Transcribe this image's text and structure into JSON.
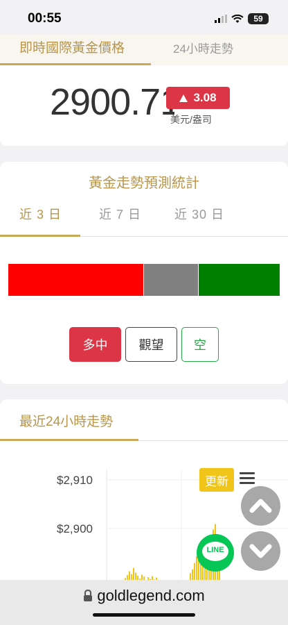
{
  "status_bar": {
    "time": "00:55",
    "battery": "59"
  },
  "top_tabs": {
    "realtime_label": "即時國際黃金價格",
    "trend24h_label": "24小時走勢"
  },
  "price": {
    "value": "2900.71",
    "change": "3.08",
    "change_direction": "up",
    "unit": "美元/盎司"
  },
  "forecast": {
    "title": "黃金走勢預測統計",
    "periods": [
      "近 3 日",
      "近 7 日",
      "近 30 日"
    ],
    "active_period_index": 0,
    "distribution_percent": {
      "long": 50,
      "watch": 20,
      "short": 30
    },
    "legend": {
      "long_label": "多中",
      "watch_label": "觀望",
      "short_label": "空"
    },
    "colors": {
      "long": "#ff0000",
      "watch": "#808080",
      "short": "#008000"
    }
  },
  "trend24h": {
    "title": "最近24小時走勢",
    "refresh_label": "更新",
    "chart_data": {
      "type": "bar",
      "ytick_labels": [
        "$2,910",
        "$2,900"
      ],
      "ylim": [
        2888,
        2912
      ],
      "grid": true,
      "color": "#f0c419",
      "visible_values": [
        2888.6,
        2889.2,
        2889.8,
        2890.4,
        2891.2,
        2890.6,
        2891.9,
        2890.9,
        2890.3,
        2889.7,
        2890.5,
        2890.1,
        2889.4,
        2890.0,
        2889.6,
        2890.2,
        2889.5,
        2889.9,
        2890.8,
        2891.6,
        2892.9,
        2894.3,
        2895.8,
        2896.6,
        2895.2,
        2896.9,
        2894.8,
        2895.9,
        2897.5,
        2899.8,
        2900.9,
        2898.6,
        2897.2
      ]
    }
  },
  "floating": {
    "line_label": "LINE"
  },
  "browser": {
    "url": "goldlegend.com"
  }
}
